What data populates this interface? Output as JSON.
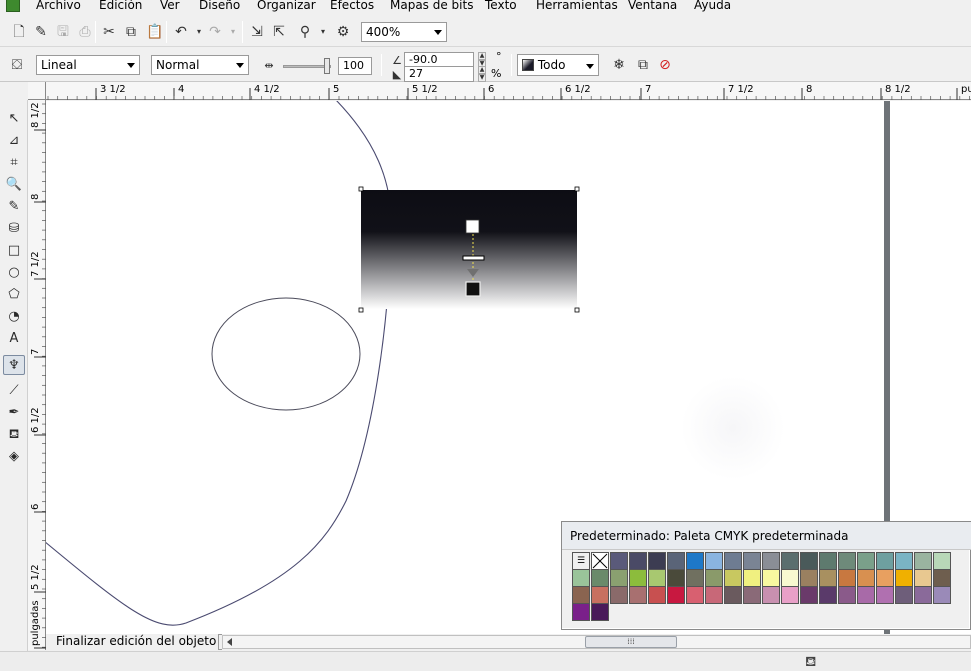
{
  "menu": [
    {
      "label": "Archivo"
    },
    {
      "label": "Edición"
    },
    {
      "label": "Ver"
    },
    {
      "label": "Diseño"
    },
    {
      "label": "Organizar"
    },
    {
      "label": "Efectos"
    },
    {
      "label": "Mapas de bits"
    },
    {
      "label": "Texto"
    },
    {
      "label": "Herramientas"
    },
    {
      "label": "Ventana"
    },
    {
      "label": "Ayuda"
    }
  ],
  "standard_toolbar": {
    "zoom_value": "400%"
  },
  "property_bar": {
    "fill_type": "Lineal",
    "blend_mode": "Normal",
    "transparency_value": "100",
    "angle_value": "-90.0",
    "edge_pad_value": "27",
    "percent_label": "%",
    "target_value": "Todo"
  },
  "ruler_h": [
    "3 1/2",
    "4",
    "4 1/2",
    "5",
    "5 1/2",
    "6",
    "6 1/2",
    "7",
    "7 1/2",
    "8",
    "8 1/2",
    "pulga"
  ],
  "ruler_v": [
    "8 1/2",
    "8",
    "7 1/2",
    "7",
    "6 1/2",
    "6",
    "5 1/2",
    "pulgadas"
  ],
  "palette": {
    "title": "Predeterminado: Paleta CMYK predeterminada",
    "colors": [
      "#5a5a7a",
      "#4a4a66",
      "#3c3c52",
      "#5a6478",
      "#1e78c8",
      "#8ab4e0",
      "#6e7c92",
      "#7a8494",
      "#8a8e96",
      "#5a6e6e",
      "#4a5a5a",
      "#5e7a6e",
      "#6e8a7a",
      "#7aa08a",
      "#6ea0a0",
      "#7ab4c4",
      "#9ab4a0",
      "#b8d8b8",
      "#9ac49a",
      "#6a8a6a",
      "#8aa070",
      "#8cbc3c",
      "#a8c870",
      "#4a4a3a",
      "#707060",
      "#8a9a6a",
      "#c8c860",
      "#f0f080",
      "#f8f8a0",
      "#f8f8d0",
      "#9a8060",
      "#a89060",
      "#c87840",
      "#d89050",
      "#e8a060",
      "#f0b000",
      "#e8c890",
      "#6e5e4e",
      "#8a6450",
      "#c87060",
      "#8a6a6a",
      "#a87070",
      "#c85050",
      "#c81840",
      "#d86070",
      "#c86878",
      "#6a5a5e",
      "#8a6a78",
      "#c890b0",
      "#e8a0c8",
      "#6a3a6a",
      "#5a3a6a",
      "#8a5a8a",
      "#a86aa8",
      "#b070b0",
      "#6e5e7a",
      "#8a6a9a",
      "#9a8ab8",
      "#7a208a",
      "#4a1a5a",
      "#5a3c7a",
      "#101010"
    ]
  },
  "status": {
    "message": "Finalizar edición del objeto"
  }
}
